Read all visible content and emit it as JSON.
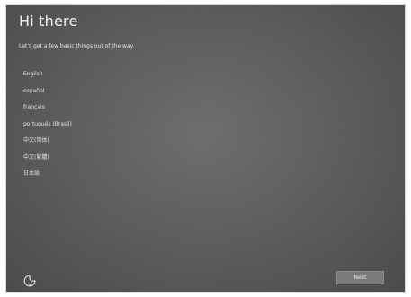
{
  "header": {
    "title": "Hi there",
    "subtitle": "Let's get a few basic things out of the way."
  },
  "languages": [
    "English",
    "español",
    "français",
    "português (Brasil)",
    "中文(简体)",
    "中文(繁體)",
    "日本語"
  ],
  "footer": {
    "ease_of_access_icon": "ease-of-access-icon",
    "next_label": "Next"
  },
  "colors": {
    "background": "#5f5f5f",
    "text": "#f2f2f2",
    "button": "#7b7b7b"
  }
}
